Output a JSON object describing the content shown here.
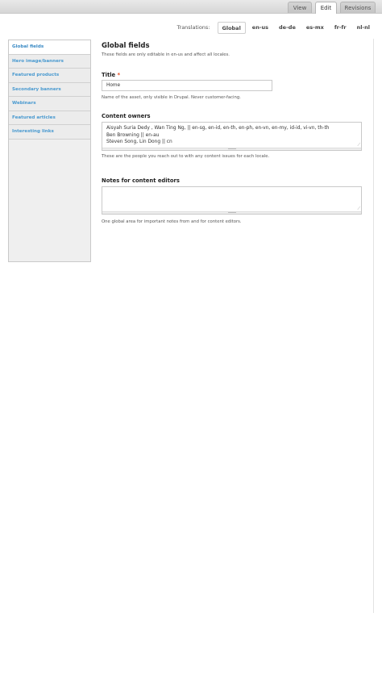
{
  "top_tabs": {
    "view": "View",
    "edit": "Edit",
    "revisions": "Revisions"
  },
  "translations": {
    "label": "Translations:",
    "items": [
      "Global",
      "en-us",
      "de-de",
      "es-mx",
      "fr-fr",
      "nl-nl"
    ],
    "active": "Global"
  },
  "sidebar": {
    "items": [
      "Global fields",
      "Hero image/banners",
      "Featured products",
      "Secondary banners",
      "Webinars",
      "Featured articles",
      "Interesting links"
    ],
    "active": "Global fields"
  },
  "main": {
    "title": "Global fields",
    "description": "These fields are only editable in en-us and affect all locales.",
    "title_field": {
      "label": "Title",
      "required_marker": "*",
      "value": "Home",
      "help": "Name of the asset, only visible in Drupal. Never customer-facing."
    },
    "content_owners": {
      "label": "Content owners",
      "lines": [
        "Aisyah Suria Dedy , Wan Ting Ng, || en-sg, en-id, en-th, en-ph, en-vn, en-my, id-id, vi-vn, th-th",
        "Ben Browning || en-au",
        "Steven Song, Lin Dong || cn"
      ],
      "help": "These are the people you reach out to with any content issues for each locale."
    },
    "notes": {
      "label": "Notes for content editors",
      "value": "",
      "help": "One global area for important notes from and for content editors."
    }
  },
  "colors": {
    "link_blue": "#4a9ad0",
    "required_red": "#e4481c"
  }
}
